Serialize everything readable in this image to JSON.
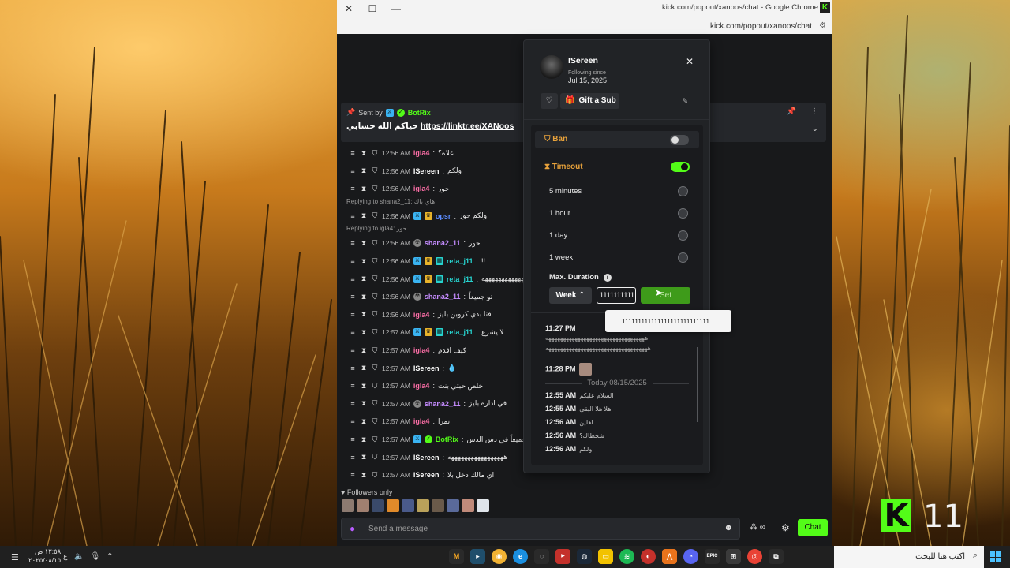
{
  "browser": {
    "title": "kick.com/popout/xanoos/chat - Google Chrome",
    "url": "kick.com/popout/xanoos/chat"
  },
  "pinned": {
    "sent_by": "Sent by",
    "sender": "BotRix",
    "message_prefix": "حياكم الله حسابي",
    "link": "https://linktr.ee/XANoos"
  },
  "messages": [
    {
      "ts": "12:56 AM",
      "user": "igla4",
      "color": "#ff6fa8",
      "badges": [],
      "text": "علاه؟"
    },
    {
      "ts": "12:56 AM",
      "user": "ISereen",
      "color": "#ffffff",
      "badges": [],
      "text": "ولكم"
    },
    {
      "ts": "12:56 AM",
      "user": "igla4",
      "color": "#ff6fa8",
      "badges": [],
      "text": "حور"
    },
    {
      "reply": "Replying to shana2_11: هاي باك"
    },
    {
      "ts": "12:56 AM",
      "user": "opsr",
      "color": "#5b8cff",
      "badges": [
        "blue",
        "gold"
      ],
      "text": "ولكم حور"
    },
    {
      "reply": "Replying to igla4: حور"
    },
    {
      "ts": "12:56 AM",
      "user": "shana2_11",
      "color": "#c58cff",
      "badges": [
        "gray"
      ],
      "text": "حور"
    },
    {
      "ts": "12:56 AM",
      "user": "reta_j11",
      "color": "#27d3cf",
      "badges": [
        "blue",
        "gold",
        "cyan"
      ],
      "text": "!!"
    },
    {
      "ts": "12:56 AM",
      "user": "reta_j11",
      "color": "#27d3cf",
      "badges": [
        "blue",
        "gold",
        "cyan"
      ],
      "text": "ههههههههههههههههه"
    },
    {
      "ts": "12:56 AM",
      "user": "shana2_11",
      "color": "#c58cff",
      "badges": [
        "gray"
      ],
      "text": "تو جميعاً"
    },
    {
      "ts": "12:56 AM",
      "user": "igla4",
      "color": "#ff6fa8",
      "badges": [],
      "text": "فنا بدي كروبن بليز"
    },
    {
      "ts": "12:57 AM",
      "user": "reta_j11",
      "color": "#27d3cf",
      "badges": [
        "blue",
        "gold",
        "cyan"
      ],
      "text": "لا يشرع"
    },
    {
      "ts": "12:57 AM",
      "user": "igla4",
      "color": "#ff6fa8",
      "badges": [],
      "text": "كيف اقدم"
    },
    {
      "ts": "12:57 AM",
      "user": "ISereen",
      "color": "#ffffff",
      "badges": [],
      "text": "💧"
    },
    {
      "ts": "12:57 AM",
      "user": "igla4",
      "color": "#ff6fa8",
      "badges": [],
      "text": "خلص حبتي بنت"
    },
    {
      "ts": "12:57 AM",
      "user": "shana2_11",
      "color": "#c58cff",
      "badges": [
        "gray"
      ],
      "text": "في ادارة بليز"
    },
    {
      "ts": "12:57 AM",
      "user": "igla4",
      "color": "#ff6fa8",
      "badges": [],
      "text": "نمرا"
    },
    {
      "ts": "12:57 AM",
      "user": "BotRix",
      "color": "#53fc18",
      "badges": [
        "blue",
        "green"
      ],
      "text": "حياكم الله جميعاً في دس الدس"
    },
    {
      "ts": "12:57 AM",
      "user": "ISereen",
      "color": "#ffffff",
      "badges": [],
      "text": "هههههههههههههههههه"
    },
    {
      "ts": "12:57 AM",
      "user": "ISereen",
      "color": "#ffffff",
      "badges": [],
      "text": "اي مالك دخل بلا"
    }
  ],
  "footer": {
    "followers_only": "Followers only",
    "send_placeholder": "Send a message",
    "chat_button": "Chat",
    "points": "∞"
  },
  "modcard": {
    "username": "ISereen",
    "following_since_label": "Following since",
    "following_date": "Jul 15, 2025",
    "gift_label": "Gift a Sub",
    "ban_label": "Ban",
    "timeout_label": "Timeout",
    "options": [
      "5 minutes",
      "1 hour",
      "1 day",
      "1 week"
    ],
    "max_duration_label": "Max. Duration",
    "unit_label": "Week",
    "duration_value": "1111111111",
    "set_label": "Set",
    "tooltip_value": "111111111111111111111111111...",
    "history": [
      {
        "time": "11:27 PM",
        "text": "ههههههههههههههههههههههههههههههههههه"
      },
      {
        "time": "",
        "text": "هههههههههههههههههههههههههههههههههههه"
      },
      {
        "time": "11:28 PM",
        "text": ""
      },
      {
        "time": "12:55 AM",
        "text": "السلام عليكم"
      },
      {
        "time": "12:55 AM",
        "text": "هلا هلا البقى"
      },
      {
        "time": "12:56 AM",
        "text": "اهلين"
      },
      {
        "time": "12:56 AM",
        "text": "شخطاك؟"
      },
      {
        "time": "12:56 AM",
        "text": "ولكم"
      }
    ],
    "today_label": "Today 08/15/2025"
  },
  "overlay": {
    "kick_letter": "K",
    "number": "11"
  },
  "taskbar": {
    "search_placeholder": "اكتب هنا للبحث",
    "time": "١٢:٥٨ ص",
    "date": "٢٠٢٥/٠٨/١٥",
    "lang": "ع"
  },
  "colors": {
    "kick_green": "#53fc18",
    "warning_orange": "#e8a23b"
  }
}
